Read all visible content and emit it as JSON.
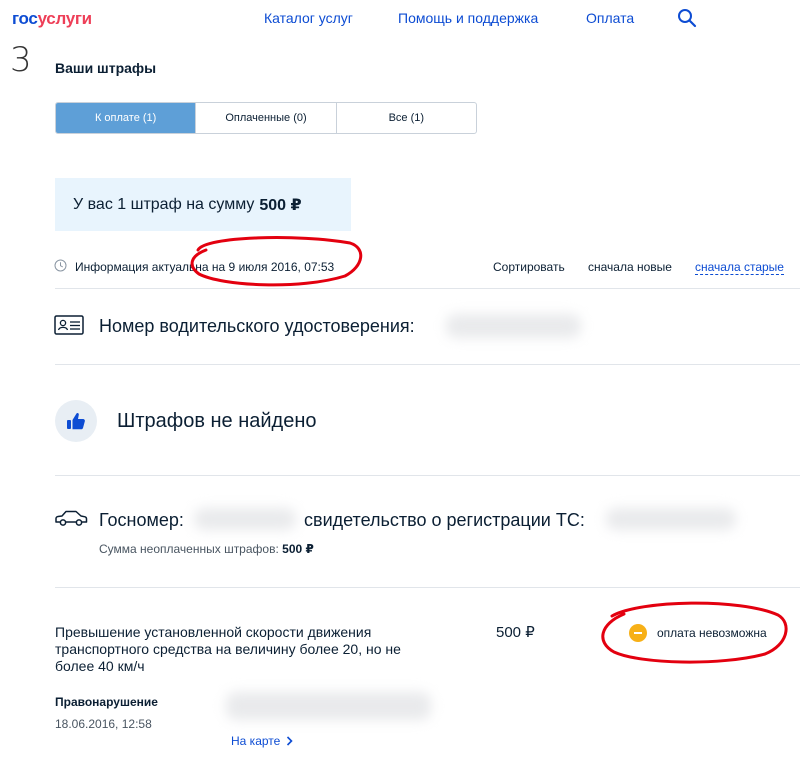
{
  "header": {
    "logo_part1": "гос",
    "logo_part2": "услуги",
    "nav": [
      "Каталог услуг",
      "Помощь и поддержка",
      "Оплата"
    ],
    "search_icon": "search-icon"
  },
  "step_number": "3",
  "page_title": "Ваши штрафы",
  "tabs": [
    {
      "label": "К оплате (1)",
      "active": true
    },
    {
      "label": "Оплаченные (0)",
      "active": false
    },
    {
      "label": "Все (1)",
      "active": false
    }
  ],
  "summary": {
    "text": "У вас 1 штраф на сумму",
    "amount": "500 ₽"
  },
  "info": {
    "text": "Информация актуальна на 9 июля 2016, 07:53",
    "sort_label": "Сортировать",
    "sort_newest": "сначала новые",
    "sort_oldest": "сначала старые"
  },
  "license": {
    "label": "Номер водительского удостоверения:"
  },
  "no_fines": {
    "text": "Штрафов не найдено"
  },
  "vehicle": {
    "plate_label": "Госномер:",
    "cert_label": "свидетельство о регистрации ТС:",
    "unpaid_label": "Сумма неоплаченных штрафов:",
    "unpaid_amount": "500 ₽"
  },
  "fine": {
    "title": "Превышение установленной скорости движения транспортного средства на величину более 20, но не более 40 км/ч",
    "amount": "500 ₽",
    "status": "оплата невозможна",
    "offense_label": "Правонарушение",
    "offense_date": "18.06.2016, 12:58",
    "map_link": "На карте"
  },
  "colors": {
    "brand_blue": "#0d4cd3",
    "brand_red": "#ee3f58",
    "tab_active": "#5e9fd7",
    "summary_bg": "#e8f4fd",
    "warning": "#f7b017",
    "annotation": "#e3000f"
  }
}
